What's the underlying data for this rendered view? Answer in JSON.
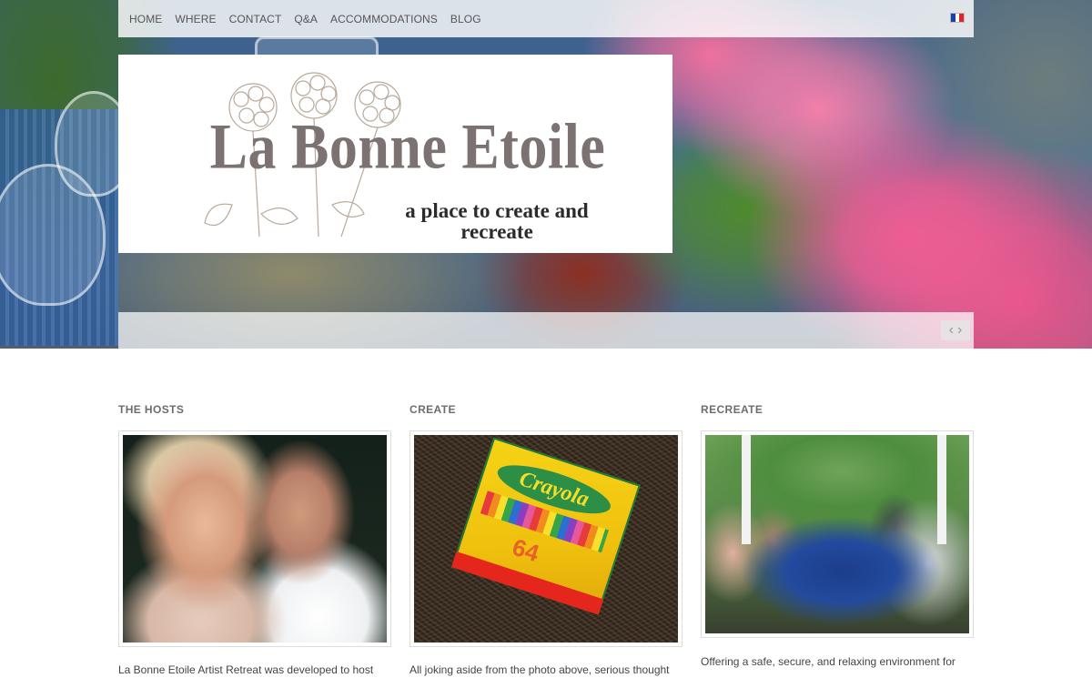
{
  "nav": {
    "items": [
      {
        "label": "HOME"
      },
      {
        "label": "WHERE"
      },
      {
        "label": "CONTACT"
      },
      {
        "label": "Q&A"
      },
      {
        "label": "ACCOMMODATIONS"
      },
      {
        "label": "BLOG"
      }
    ],
    "language_flag": "flag-france-icon"
  },
  "logo": {
    "title": "La Bonne Etoile",
    "tagline": "a place to create and recreate"
  },
  "slider": {
    "prev_symbol": "‹",
    "next_symbol": "›"
  },
  "columns": [
    {
      "heading": "THE HOSTS",
      "text": "La Bonne Etoile Artist Retreat was developed to host"
    },
    {
      "heading": "CREATE",
      "text": "All joking aside from the photo above, serious thought"
    },
    {
      "heading": "RECREATE",
      "text": "Offering a safe, secure, and relaxing environment for"
    }
  ],
  "crayon_box": {
    "brand": "Crayola",
    "count": "64"
  },
  "colors": {
    "nav_text": "#555555",
    "logo_title": "#7b7271",
    "heading": "#6d6d6d",
    "flag_blue": "#1f3fa8",
    "flag_white": "#ffffff",
    "flag_red": "#e0262b"
  }
}
